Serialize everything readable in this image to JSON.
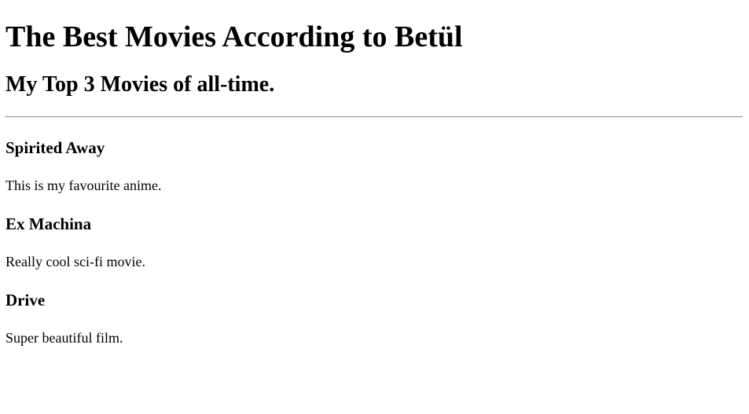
{
  "page": {
    "title": "The Best Movies According to Betül",
    "subtitle": "My Top 3 Movies of all-time."
  },
  "movies": [
    {
      "title": "Spirited Away",
      "description": "This is my favourite anime."
    },
    {
      "title": "Ex Machina",
      "description": "Really cool sci-fi movie."
    },
    {
      "title": "Drive",
      "description": "Super beautiful film."
    }
  ]
}
